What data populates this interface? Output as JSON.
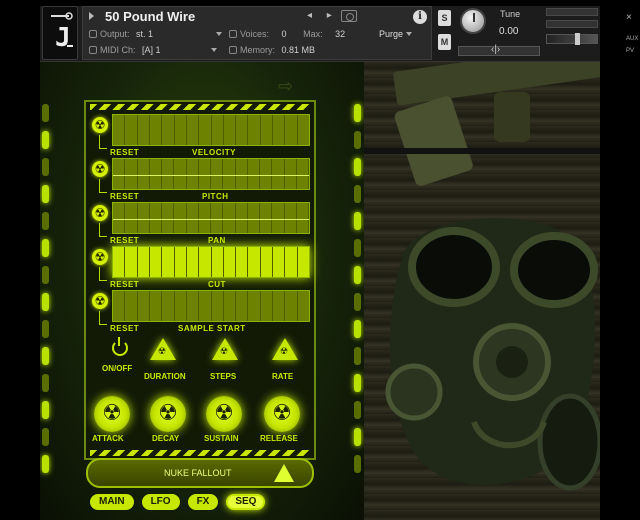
{
  "header": {
    "instrument_name": "50 Pound Wire",
    "output_label": "Output:",
    "output_value": "st. 1",
    "voices_label": "Voices:",
    "voices_value": "0",
    "max_label": "Max:",
    "max_value": "32",
    "purge_label": "Purge",
    "midi_label": "MIDI Ch:",
    "midi_value": "[A]  1",
    "memory_label": "Memory:",
    "memory_value": "0.81 MB",
    "s_button": "S",
    "m_button": "M",
    "tune_label": "Tune",
    "tune_value": "0.00",
    "aux_label": "AUX",
    "pv_label": "PV",
    "close_glyph": "×",
    "info_glyph": "i",
    "nav_glyphs": "◂ ▸"
  },
  "sequencer": {
    "reset_label": "RESET",
    "rows": [
      {
        "label": "VELOCITY"
      },
      {
        "label": "PITCH"
      },
      {
        "label": "PAN"
      },
      {
        "label": "CUT"
      },
      {
        "label": "SAMPLE START"
      }
    ],
    "steps": 16
  },
  "controls": {
    "onoff": "ON/OFF",
    "duration": "DURATION",
    "steps": "STEPS",
    "rate": "RATE"
  },
  "envelope": {
    "attack": "ATTACK",
    "decay": "DECAY",
    "sustain": "SUSTAIN",
    "release": "RELEASE"
  },
  "preset": "NUKE FALLOUT",
  "tabs": [
    "MAIN",
    "LFO",
    "FX",
    "SEQ"
  ],
  "active_tab": "SEQ",
  "colors": {
    "accent": "#c6e800",
    "dark_green": "#6d8200"
  }
}
